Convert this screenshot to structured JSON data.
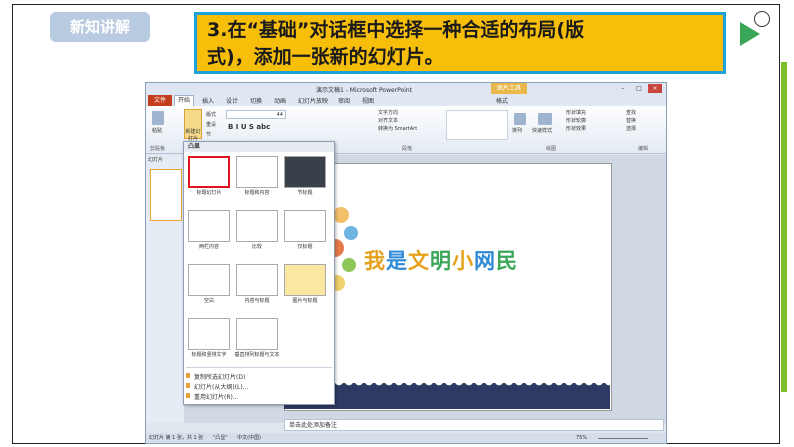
{
  "badge": {
    "label": "新知讲解"
  },
  "instruction": {
    "line1": "3.在“基础”对话框中选择一种合适的布局(版",
    "line2": "式)，添加一张新的幻灯片。"
  },
  "window": {
    "title": "演示文稿1 - Microsoft PowerPoint",
    "contextual_tab": "图片工具",
    "controls": [
      "–",
      "□",
      "×"
    ]
  },
  "ribbon": {
    "tabs": [
      "文件",
      "开始",
      "插入",
      "设计",
      "切换",
      "动画",
      "幻灯片放映",
      "审阅",
      "视图",
      "格式"
    ],
    "new_slide_label": "新建幻灯片",
    "paste_label": "粘贴",
    "layout_label": "版式",
    "reset_label": "重设",
    "section_label": "节",
    "font_size": "44",
    "text_direction": "文字方向",
    "align_text": "对齐文本",
    "smartart": "转换为 SmartArt",
    "arrange_label": "排列",
    "quick_styles_label": "快速样式",
    "shape_fill": "形状填充",
    "shape_outline": "形状轮廓",
    "shape_effects": "形状效果",
    "find": "查找",
    "replace": "替换",
    "select": "选择",
    "groups": [
      "剪贴板",
      "段落",
      "绘图",
      "编辑"
    ]
  },
  "left_panel": {
    "tabs": [
      "幻灯片",
      "大"
    ],
    "thumb_number": "1"
  },
  "gallery": {
    "header": "凸显",
    "layouts": [
      {
        "label": "标题幻灯片"
      },
      {
        "label": "标题和内容"
      },
      {
        "label": "节标题"
      },
      {
        "label": "两栏内容"
      },
      {
        "label": "比较"
      },
      {
        "label": "仅标题"
      },
      {
        "label": "空白"
      },
      {
        "label": "内容与标题"
      },
      {
        "label": "图片与标题"
      },
      {
        "label": "标题和竖排文字"
      },
      {
        "label": "垂直排列标题与文本"
      }
    ],
    "commands": [
      "复制所选幻灯片(D)",
      "幻灯片(从大纲)(L)...",
      "重用幻灯片(R)..."
    ]
  },
  "slide": {
    "title_chars": [
      "我",
      "是",
      "文",
      "明",
      "小",
      "网",
      "民"
    ],
    "title_colors": [
      "#e6a11c",
      "#2e8ad6",
      "#e6a11c",
      "#3aa657",
      "#e6a11c",
      "#2e8ad6",
      "#3aa657"
    ]
  },
  "notes": {
    "placeholder": "单击此处添加备注"
  },
  "status": {
    "slide_info": "幻灯片 第 1 张，共 1 张",
    "theme": "\"凸显\"",
    "language": "中文(中国)",
    "zoom": "75%"
  },
  "colors": {
    "accent": "#f7bf0a",
    "instruction_border": "#1aa3d9",
    "green": "#7fbf2a",
    "file_tab": "#c43e1c"
  }
}
